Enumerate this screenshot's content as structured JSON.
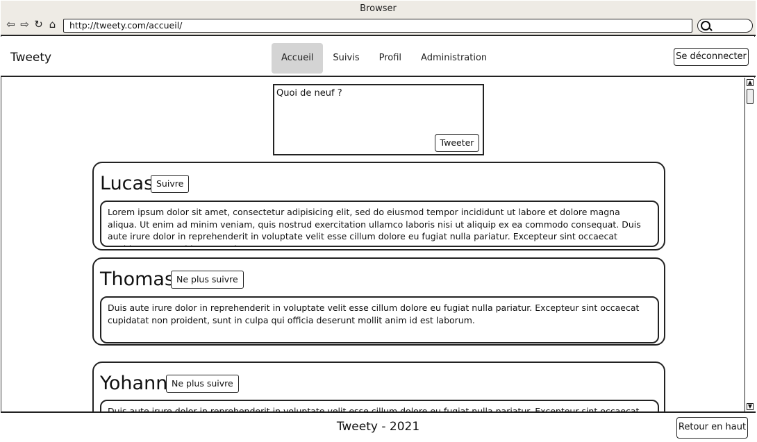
{
  "browser": {
    "title": "Browser",
    "url": "http://tweety.com/accueil/",
    "nav_icons": [
      "back-arrow-icon",
      "forward-arrow-icon",
      "reload-icon",
      "home-icon"
    ]
  },
  "header": {
    "brand": "Tweety",
    "tabs": [
      {
        "label": "Accueil",
        "active": true
      },
      {
        "label": "Suivis",
        "active": false
      },
      {
        "label": "Profil",
        "active": false
      },
      {
        "label": "Administration",
        "active": false
      }
    ],
    "logout_label": "Se déconnecter"
  },
  "composer": {
    "placeholder": "Quoi de neuf ?",
    "submit_label": "Tweeter"
  },
  "posts": [
    {
      "author": "Lucas",
      "follow_label": "Suivre",
      "text": "Lorem ipsum dolor sit amet, consectetur adipisicing elit, sed do eiusmod tempor incididunt ut labore et dolore magna aliqua. Ut enim ad minim veniam, quis nostrud exercitation ullamco laboris nisi ut aliquip ex ea commodo consequat. Duis aute irure dolor in reprehenderit in voluptate velit esse cillum dolore eu fugiat nulla pariatur. Excepteur sint occaecat cupidatat non proident, sunt in"
    },
    {
      "author": "Thomas",
      "follow_label": "Ne plus suivre",
      "text": "Duis aute irure dolor in reprehenderit in voluptate velit esse cillum dolore eu fugiat nulla pariatur. Excepteur sint occaecat cupidatat non proident, sunt in culpa qui officia deserunt mollit anim id est laborum."
    },
    {
      "author": "Yohann",
      "follow_label": "Ne plus suivre",
      "text": "Duis aute irure dolor in reprehenderit in voluptate velit esse cillum dolore eu fugiat nulla pariatur. Excepteur sint occaecat cupidatat"
    }
  ],
  "footer": {
    "text": "Tweety - 2021",
    "back_to_top_label": "Retour en haut"
  }
}
